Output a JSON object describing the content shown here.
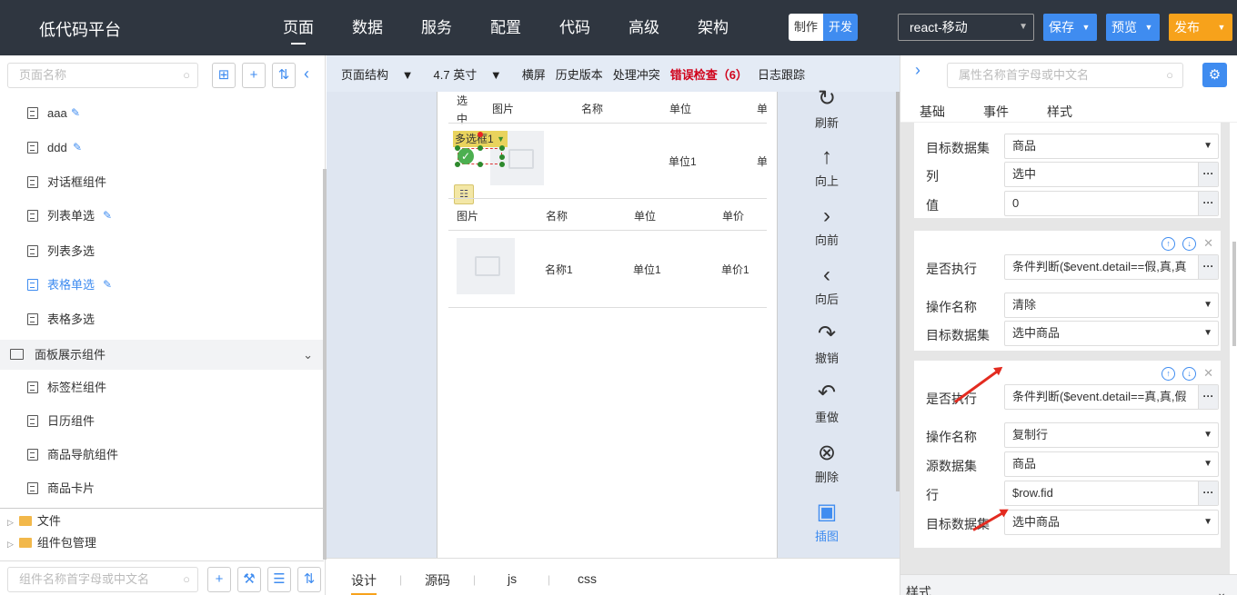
{
  "app": {
    "title": "低代码平台"
  },
  "nav": [
    "页面",
    "数据",
    "服务",
    "配置",
    "代码",
    "高级",
    "架构"
  ],
  "mode": {
    "make": "制作",
    "dev": "开发"
  },
  "project": {
    "value": "react-移动"
  },
  "buttons": {
    "save": "保存",
    "preview": "预览",
    "publish": "发布"
  },
  "left": {
    "search_placeholder": "页面名称",
    "pages": [
      {
        "label": "aaa",
        "edit": true
      },
      {
        "label": "ddd",
        "edit": true
      },
      {
        "label": "对话框组件",
        "edit": false
      },
      {
        "label": "列表单选",
        "edit": true
      },
      {
        "label": "列表多选",
        "edit": false
      },
      {
        "label": "表格单选",
        "edit": true,
        "selected": true
      },
      {
        "label": "表格多选",
        "edit": false
      }
    ],
    "folder": "面板展示组件",
    "folder_pages": [
      "标签栏组件",
      "日历组件",
      "商品导航组件",
      "商品卡片"
    ],
    "files": [
      "文件",
      "组件包管理"
    ],
    "comp_search_placeholder": "组件名称首字母或中文名"
  },
  "toolbar": {
    "structure": "页面结构",
    "device": "4.7 英寸",
    "landscape": "横屏",
    "history": "历史版本",
    "conflict": "处理冲突",
    "errors": "错误检查（6）",
    "log": "日志跟踪"
  },
  "canvas": {
    "table1": {
      "headers": [
        "选中",
        "图片",
        "名称",
        "单位",
        "单价"
      ],
      "row": [
        "单位1",
        "单价"
      ]
    },
    "multiselect": "多选框1",
    "table2": {
      "headers": [
        "图片",
        "名称",
        "单位",
        "单价"
      ],
      "row": [
        "名称1",
        "单位1",
        "单价1"
      ]
    }
  },
  "actions": [
    "刷新",
    "向上",
    "向前",
    "向后",
    "撤销",
    "重做",
    "删除",
    "插图"
  ],
  "bottom_tabs": [
    "设计",
    "源码",
    "js",
    "css"
  ],
  "right": {
    "search_placeholder": "属性名称首字母或中文名",
    "tabs": [
      "基础",
      "事件",
      "样式"
    ],
    "card1": [
      {
        "label": "目标数据集",
        "value": "商品",
        "type": "select"
      },
      {
        "label": "列",
        "value": "选中",
        "type": "dots"
      },
      {
        "label": "值",
        "value": "0",
        "type": "dots"
      }
    ],
    "card2": [
      {
        "label": "是否执行",
        "value": "条件判断($event.detail==假,真,真",
        "type": "dots"
      },
      {
        "label": "操作名称",
        "value": "清除",
        "type": "select"
      },
      {
        "label": "目标数据集",
        "value": "选中商品",
        "type": "select"
      }
    ],
    "card3": [
      {
        "label": "是否执行",
        "value": "条件判断($event.detail==真,真,假",
        "type": "dots"
      },
      {
        "label": "操作名称",
        "value": "复制行",
        "type": "select"
      },
      {
        "label": "源数据集",
        "value": "商品",
        "type": "select"
      },
      {
        "label": "行",
        "value": "$row.fid",
        "type": "dots"
      },
      {
        "label": "目标数据集",
        "value": "选中商品",
        "type": "select"
      }
    ],
    "style_section": "样式"
  }
}
